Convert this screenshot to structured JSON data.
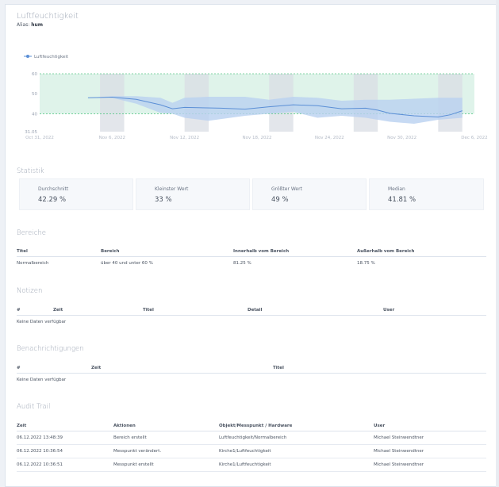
{
  "header": {
    "title": "Luftfeuchtigkeit",
    "alias_label": "Alias:",
    "alias_value": "hum"
  },
  "chart_data": {
    "type": "line",
    "legend": [
      "Luftfeuchtigkeit"
    ],
    "legend_placement": "top-left",
    "yticks": [
      60,
      50,
      40
    ],
    "ymin_label": "31.05",
    "ylim": [
      31.05,
      60
    ],
    "xticks": [
      "Oct 31, 2022",
      "Nov 6, 2022",
      "Nov 12, 2022",
      "Nov 18, 2022",
      "Nov 24, 2022",
      "Nov 30, 2022",
      "Dec 6, 2022"
    ],
    "normal_range": [
      40,
      60
    ],
    "colors": {
      "line": "#5b8fd6",
      "band": "#b9d1f0",
      "range": "#dff3ea",
      "range_line": "#5cc98a",
      "weekend": "#d9dde4"
    },
    "series": [
      {
        "name": "Luftfeuchtigkeit",
        "mean": [
          [
            "2022-11-04",
            48
          ],
          [
            "2022-11-06",
            48.3
          ],
          [
            "2022-11-08",
            47.2
          ],
          [
            "2022-11-10",
            44.5
          ],
          [
            "2022-11-11",
            42.5
          ],
          [
            "2022-11-12",
            43.2
          ],
          [
            "2022-11-15",
            42.8
          ],
          [
            "2022-11-17",
            42.3
          ],
          [
            "2022-11-19",
            43.5
          ],
          [
            "2022-11-21",
            44.5
          ],
          [
            "2022-11-23",
            44
          ],
          [
            "2022-11-25",
            42.5
          ],
          [
            "2022-11-27",
            42.8
          ],
          [
            "2022-11-28",
            41.8
          ],
          [
            "2022-11-29",
            40.2
          ],
          [
            "2022-12-01",
            39
          ],
          [
            "2022-12-03",
            38.4
          ],
          [
            "2022-12-04",
            39.5
          ],
          [
            "2022-12-05",
            41.5
          ]
        ],
        "min": [
          [
            "2022-11-04",
            48
          ],
          [
            "2022-11-06",
            48
          ],
          [
            "2022-11-08",
            45
          ],
          [
            "2022-11-10",
            40.5
          ],
          [
            "2022-11-11",
            40
          ],
          [
            "2022-11-12",
            38
          ],
          [
            "2022-11-14",
            36.5
          ],
          [
            "2022-11-17",
            39
          ],
          [
            "2022-11-19",
            40
          ],
          [
            "2022-11-21",
            41
          ],
          [
            "2022-11-23",
            38
          ],
          [
            "2022-11-25",
            39
          ],
          [
            "2022-11-27",
            38
          ],
          [
            "2022-11-29",
            36
          ],
          [
            "2022-12-01",
            35
          ],
          [
            "2022-12-03",
            37
          ],
          [
            "2022-12-05",
            38
          ]
        ],
        "max": [
          [
            "2022-11-04",
            48
          ],
          [
            "2022-11-06",
            48.8
          ],
          [
            "2022-11-08",
            48.8
          ],
          [
            "2022-11-10",
            48
          ],
          [
            "2022-11-11",
            45.5
          ],
          [
            "2022-11-12",
            48
          ],
          [
            "2022-11-14",
            48.5
          ],
          [
            "2022-11-17",
            48.5
          ],
          [
            "2022-11-19",
            47
          ],
          [
            "2022-11-21",
            48.5
          ],
          [
            "2022-11-23",
            48
          ],
          [
            "2022-11-25",
            46.5
          ],
          [
            "2022-11-27",
            47
          ],
          [
            "2022-11-29",
            47
          ],
          [
            "2022-12-01",
            47.5
          ],
          [
            "2022-12-03",
            48
          ],
          [
            "2022-12-05",
            48
          ]
        ]
      }
    ],
    "weekend_bands": [
      [
        "2022-11-05",
        "2022-11-07"
      ],
      [
        "2022-11-12",
        "2022-11-14"
      ],
      [
        "2022-11-19",
        "2022-11-21"
      ],
      [
        "2022-11-26",
        "2022-11-28"
      ],
      [
        "2022-12-03",
        "2022-12-05"
      ]
    ]
  },
  "statistik": {
    "heading": "Statistik",
    "items": [
      {
        "label": "Durchschnitt",
        "value": "42.29 %"
      },
      {
        "label": "Kleinster Wert",
        "value": "33 %"
      },
      {
        "label": "Größter Wert",
        "value": "49 %"
      },
      {
        "label": "Median",
        "value": "41.81 %"
      }
    ]
  },
  "bereiche": {
    "heading": "Bereiche",
    "columns": [
      "Titel",
      "Bereich",
      "Innerhalb vom Bereich",
      "Außerhalb vom Bereich"
    ],
    "rows": [
      [
        "Normalbereich",
        "über 40 und unter 60 %",
        "81.25 %",
        "18.75 %"
      ]
    ]
  },
  "notizen": {
    "heading": "Notizen",
    "columns": [
      "#",
      "Zeit",
      "Titel",
      "Detail",
      "User"
    ],
    "empty": "Keine Daten verfügbar"
  },
  "benachrichtigungen": {
    "heading": "Benachrichtigungen",
    "columns": [
      "#",
      "Zeit",
      "Titel"
    ],
    "empty": "Keine Daten verfügbar"
  },
  "audit": {
    "heading": "Audit Trail",
    "columns": [
      "Zeit",
      "Aktionen",
      "Objekt/Messpunkt / Hardware",
      "User"
    ],
    "rows": [
      [
        "06.12.2022 13:48:39",
        "Bereich erstellt",
        "Luftfeuchtigkeit/Normalbereich",
        "Michael Steinwendtner"
      ],
      [
        "06.12.2022 10:36:54",
        "Messpunkt verändert.",
        "Kirche1/Luftfeuchtigkeit",
        "Michael Steinwendtner"
      ],
      [
        "06.12.2022 10:36:51",
        "Messpunkt erstellt",
        "Kirche1/Luftfeuchtigkeit",
        "Michael Steinwendtner"
      ]
    ]
  }
}
